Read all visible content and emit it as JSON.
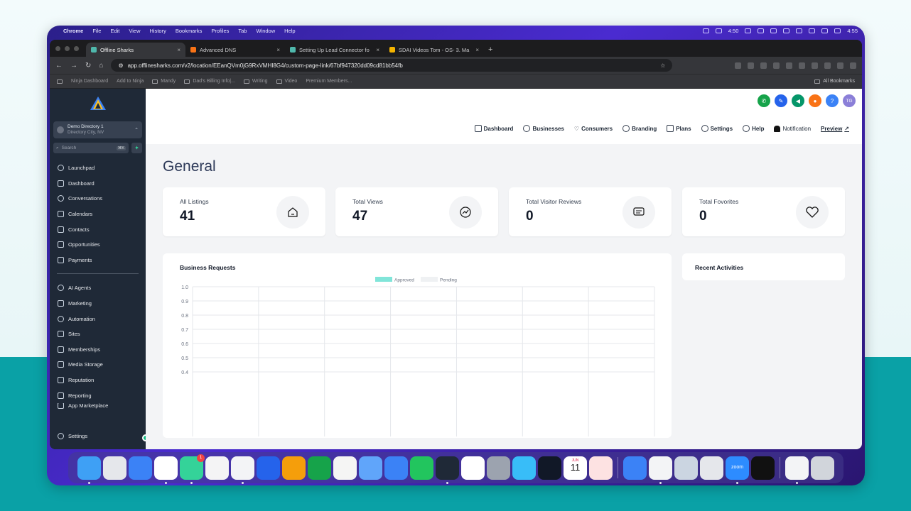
{
  "menubar": {
    "app": "Chrome",
    "items": [
      "File",
      "Edit",
      "View",
      "History",
      "Bookmarks",
      "Profiles",
      "Tab",
      "Window",
      "Help"
    ],
    "time_left": "4:50",
    "clock": "4:55"
  },
  "tabs": [
    {
      "title": "Offline Sharks",
      "active": true,
      "favicon_color": "#4fb8ac"
    },
    {
      "title": "Advanced DNS",
      "active": false,
      "favicon_color": "#f97316"
    },
    {
      "title": "Setting Up Lead Connector fo",
      "active": false,
      "favicon_color": "#4fb8ac"
    },
    {
      "title": "SDAI Videos Tom - OS- 3. Ma",
      "active": false,
      "favicon_color": "#f5b400"
    }
  ],
  "toolbar": {
    "url": "app.offlinesharks.com/v2/location/EEanQVm0jG9RxVMHI8G4/custom-page-link/67bf947320dd09cd81bb54fb"
  },
  "bookmarks": {
    "items": [
      "Ninja Dashboard",
      "Add to Ninja",
      "Mandy",
      "Dad's Billing Info|...",
      "Writing",
      "Video",
      "Premium Members..."
    ],
    "all_label": "All Bookmarks"
  },
  "sidebar": {
    "location_name": "Demo Directory 1",
    "location_sub": "Directory City, NV",
    "search_placeholder": "Search",
    "search_kbd": "⌘K",
    "items_top": [
      "Launchpad",
      "Dashboard",
      "Conversations",
      "Calendars",
      "Contacts",
      "Opportunities",
      "Payments"
    ],
    "items_bottom": [
      "AI Agents",
      "Marketing",
      "Automation",
      "Sites",
      "Memberships",
      "Media Storage",
      "Reputation",
      "Reporting",
      "App Marketplace"
    ],
    "settings_label": "Settings"
  },
  "topbar": {
    "avatar_initials": "TG"
  },
  "subnav": {
    "items": [
      "Dashboard",
      "Businesses",
      "Consumers",
      "Branding",
      "Plans",
      "Settings",
      "Help"
    ],
    "notification": "Notification",
    "preview": "Preview"
  },
  "main": {
    "title": "General",
    "stats": [
      {
        "label": "All Listings",
        "value": "41",
        "icon": "home-icon"
      },
      {
        "label": "Total Views",
        "value": "47",
        "icon": "trend-chat-icon"
      },
      {
        "label": "Total Visitor Reviews",
        "value": "0",
        "icon": "message-icon"
      },
      {
        "label": "Total Fovorites",
        "value": "0",
        "icon": "heart-icon"
      }
    ],
    "recent_title": "Recent Activities"
  },
  "chart_data": {
    "type": "bar",
    "title": "Business Requests",
    "categories": [],
    "series": [
      {
        "name": "Approved",
        "values": [],
        "color": "#2dd4bf"
      },
      {
        "name": "Pending",
        "values": [],
        "color": "#e5e7eb"
      }
    ],
    "ylim": [
      0,
      1.0
    ],
    "yticks": [
      "1.0",
      "0.9",
      "0.8",
      "0.7",
      "0.6",
      "0.5",
      "0.4"
    ],
    "grid": true,
    "legend": "top-center"
  },
  "dock": {
    "apps": [
      "Finder",
      "Launchpad",
      "Safari",
      "Chrome",
      "Messages",
      "Asana",
      "Klack",
      "Word",
      "Tes",
      "Excel",
      "TextEdit",
      "Keynote",
      "App Store",
      "Evernote",
      "OBS",
      "Slack",
      "System Settings",
      "Skitch",
      "Screen Clock",
      "Calendar",
      "Cardhop",
      "Network Radar",
      "Screens",
      "Preview",
      "Screen Sharing",
      "Zoom",
      "CapCut",
      "Documents",
      "Trash"
    ],
    "messages_badge": "1",
    "calendar_month": "JUN",
    "calendar_day": "11",
    "zoom_label": "zoom"
  }
}
